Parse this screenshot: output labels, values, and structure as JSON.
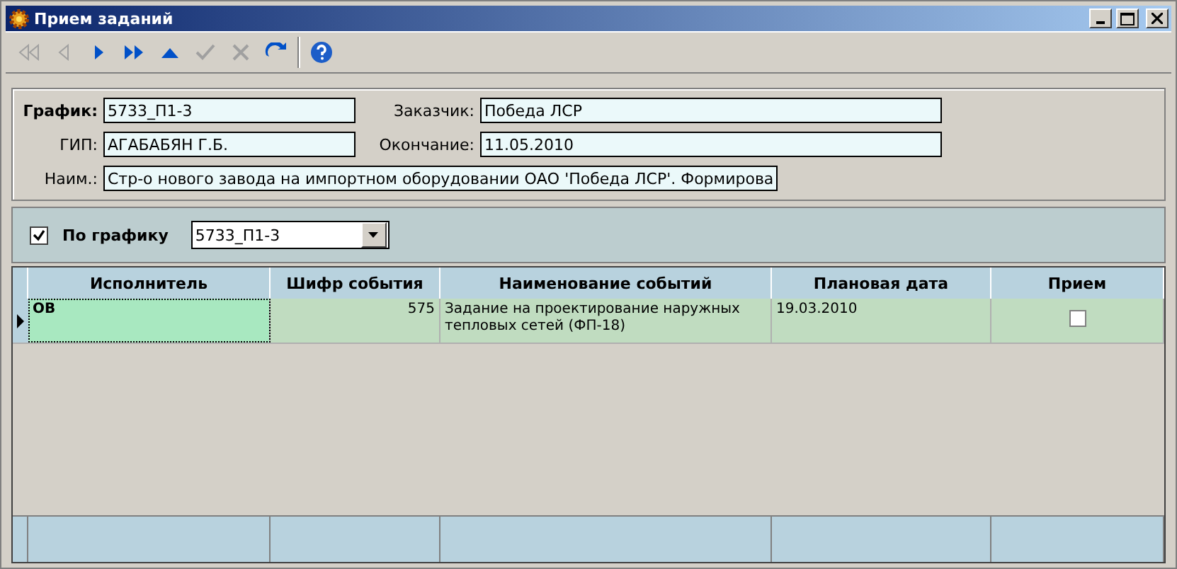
{
  "window": {
    "title": "Прием заданий"
  },
  "toolbar": [
    {
      "kind": "first",
      "disabled": true
    },
    {
      "kind": "prev",
      "disabled": true
    },
    {
      "kind": "next",
      "disabled": false
    },
    {
      "kind": "last",
      "disabled": false
    },
    {
      "kind": "up",
      "disabled": false
    },
    {
      "kind": "check",
      "disabled": true
    },
    {
      "kind": "cancel",
      "disabled": true
    },
    {
      "kind": "refresh",
      "disabled": false
    },
    {
      "kind": "sep"
    },
    {
      "kind": "help"
    }
  ],
  "form": {
    "schedule": {
      "label": "График:",
      "value": "5733_П1-3"
    },
    "customer": {
      "label": "Заказчик:",
      "value": "Победа ЛСР"
    },
    "gip": {
      "label": "ГИП:",
      "value": "АГАБАБЯН Г.Б."
    },
    "end": {
      "label": "Окончание:",
      "value": "11.05.2010"
    },
    "name": {
      "label": "Наим.:",
      "value": "Стр-о нового завода на импортном оборудовании ОАО 'Победа ЛСР'. Формирова"
    }
  },
  "filter": {
    "label": "По графику",
    "checked": true,
    "value": "5733_П1-3"
  },
  "table": {
    "columns": [
      "Исполнитель",
      "Шифр события",
      "Наименование событий",
      "Плановая дата",
      "Прием"
    ],
    "rows": [
      {
        "selected": true,
        "cells": [
          "ОВ",
          "575",
          "Задание на проектирование наружных тепловых сетей (ФП-18)",
          "19.03.2010"
        ],
        "accepted": false
      }
    ]
  }
}
